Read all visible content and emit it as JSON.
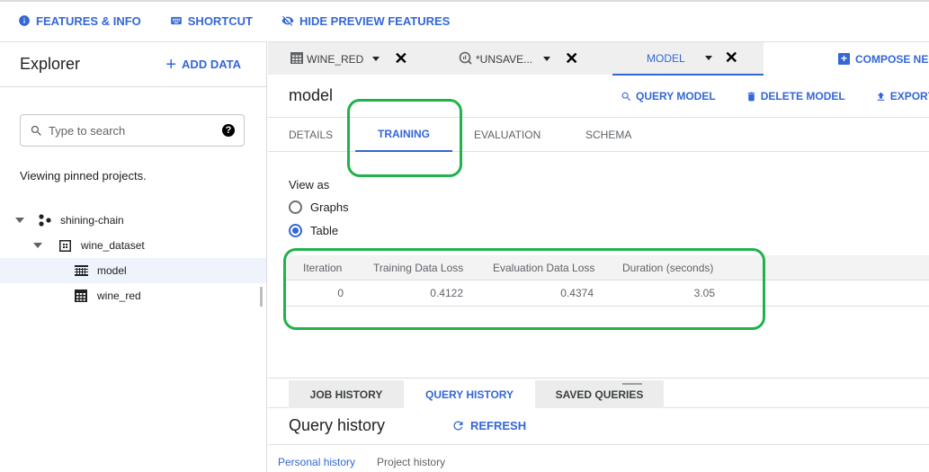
{
  "topbar": {
    "items": [
      {
        "label": "FEATURES & INFO",
        "icon": "info-icon"
      },
      {
        "label": "SHORTCUT",
        "icon": "keyboard-icon"
      },
      {
        "label": "HIDE PREVIEW FEATURES",
        "icon": "eye-off-icon"
      }
    ]
  },
  "sidebar": {
    "title": "Explorer",
    "add_data_label": "ADD DATA",
    "search_placeholder": "Type to search",
    "help_glyph": "?",
    "pinned_text": "Viewing pinned projects.",
    "tree": [
      {
        "label": "shining-chain",
        "type": "project",
        "level": 0,
        "expanded": true
      },
      {
        "label": "wine_dataset",
        "type": "dataset",
        "level": 1,
        "expanded": true
      },
      {
        "label": "model",
        "type": "model",
        "level": 2,
        "selected": true
      },
      {
        "label": "wine_red",
        "type": "table",
        "level": 2
      }
    ]
  },
  "editor_tabs": [
    {
      "label": "WINE_RED",
      "icon": "table-icon",
      "active": false
    },
    {
      "label": "*UNSAVE...",
      "icon": "query-icon",
      "active": false
    },
    {
      "label": "MODEL",
      "icon": "",
      "active": true
    }
  ],
  "compose_label": "COMPOSE NE",
  "model": {
    "title": "model",
    "actions": [
      {
        "label": "QUERY MODEL",
        "icon": "search-icon"
      },
      {
        "label": "DELETE MODEL",
        "icon": "trash-icon"
      },
      {
        "label": "EXPORT",
        "icon": "export-icon"
      }
    ],
    "tabs": [
      {
        "label": "DETAILS",
        "active": false
      },
      {
        "label": "TRAINING",
        "active": true
      },
      {
        "label": "EVALUATION",
        "active": false
      },
      {
        "label": "SCHEMA",
        "active": false
      }
    ],
    "view_as_label": "View as",
    "view_options": [
      {
        "label": "Graphs",
        "selected": false
      },
      {
        "label": "Table",
        "selected": true
      }
    ],
    "table": {
      "columns": [
        "Iteration",
        "Training Data Loss",
        "Evaluation Data Loss",
        "Duration (seconds)"
      ],
      "rows": [
        [
          "0",
          "0.4122",
          "0.4374",
          "3.05"
        ]
      ]
    }
  },
  "bottom_panel": {
    "tabs": [
      {
        "label": "JOB HISTORY",
        "active": false
      },
      {
        "label": "QUERY HISTORY",
        "active": true
      },
      {
        "label": "SAVED QUERIES",
        "active": false
      }
    ],
    "title": "Query history",
    "refresh_label": "REFRESH",
    "subtabs": [
      {
        "label": "Personal history",
        "active": true
      },
      {
        "label": "Project history",
        "active": false
      }
    ]
  },
  "colors": {
    "accent": "#3367d6",
    "highlight": "#22b14c"
  }
}
